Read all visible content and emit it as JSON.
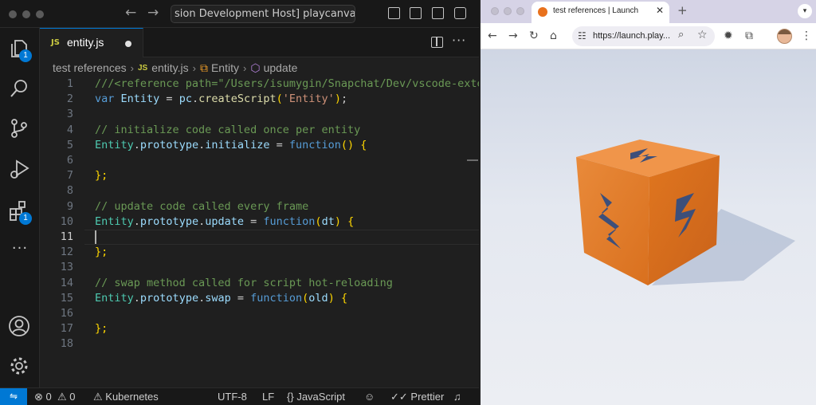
{
  "vscode": {
    "title": "[Extension Development Host] playcanvas (Workspace)",
    "title_visible": "sion Development Host] playcanvas (W",
    "tab": {
      "label": "entity.js",
      "icon_text": "JS",
      "dirty": true
    },
    "breadcrumb": [
      "test references",
      "entity.js",
      "Entity",
      "update"
    ],
    "badges": {
      "explorer": "1",
      "extensions": "1"
    },
    "current_line": 11,
    "lines": [
      {
        "n": "1",
        "tokens": [
          [
            "c",
            "///<reference path=\"/Users/isumygin/Snapchat/Dev/vscode-extensi"
          ]
        ]
      },
      {
        "n": "2",
        "tokens": [
          [
            "k",
            "var "
          ],
          [
            "v",
            "Entity"
          ],
          [
            "p",
            " = "
          ],
          [
            "v",
            "pc"
          ],
          [
            "p",
            "."
          ],
          [
            "f",
            "createScript"
          ],
          [
            "y",
            "("
          ],
          [
            "s",
            "'Entity'"
          ],
          [
            "y",
            ")"
          ],
          [
            "p",
            ";"
          ]
        ]
      },
      {
        "n": "3",
        "tokens": []
      },
      {
        "n": "4",
        "tokens": [
          [
            "c",
            "// initialize code called once per entity"
          ]
        ]
      },
      {
        "n": "5",
        "tokens": [
          [
            "t",
            "Entity"
          ],
          [
            "p",
            "."
          ],
          [
            "v",
            "prototype"
          ],
          [
            "p",
            "."
          ],
          [
            "v",
            "initialize"
          ],
          [
            "p",
            " = "
          ],
          [
            "k",
            "function"
          ],
          [
            "y",
            "() {"
          ]
        ]
      },
      {
        "n": "6",
        "tokens": []
      },
      {
        "n": "7",
        "tokens": [
          [
            "y",
            "};"
          ]
        ]
      },
      {
        "n": "8",
        "tokens": []
      },
      {
        "n": "9",
        "tokens": [
          [
            "c",
            "// update code called every frame"
          ]
        ]
      },
      {
        "n": "10",
        "tokens": [
          [
            "t",
            "Entity"
          ],
          [
            "p",
            "."
          ],
          [
            "v",
            "prototype"
          ],
          [
            "p",
            "."
          ],
          [
            "v",
            "update"
          ],
          [
            "p",
            " = "
          ],
          [
            "k",
            "function"
          ],
          [
            "y",
            "("
          ],
          [
            "v",
            "dt"
          ],
          [
            "y",
            ") {"
          ]
        ]
      },
      {
        "n": "11",
        "tokens": []
      },
      {
        "n": "12",
        "tokens": [
          [
            "y",
            "};"
          ]
        ]
      },
      {
        "n": "13",
        "tokens": []
      },
      {
        "n": "14",
        "tokens": [
          [
            "c",
            "// swap method called for script hot-reloading"
          ]
        ]
      },
      {
        "n": "15",
        "tokens": [
          [
            "t",
            "Entity"
          ],
          [
            "p",
            "."
          ],
          [
            "v",
            "prototype"
          ],
          [
            "p",
            "."
          ],
          [
            "v",
            "swap"
          ],
          [
            "p",
            " = "
          ],
          [
            "k",
            "function"
          ],
          [
            "y",
            "("
          ],
          [
            "v",
            "old"
          ],
          [
            "y",
            ") {"
          ]
        ]
      },
      {
        "n": "16",
        "tokens": []
      },
      {
        "n": "17",
        "tokens": [
          [
            "y",
            "};"
          ]
        ]
      },
      {
        "n": "18",
        "tokens": []
      }
    ],
    "status": {
      "errors": "0",
      "warnings": "0",
      "kubernetes": "Kubernetes",
      "encoding": "UTF-8",
      "eol": "LF",
      "language": "JavaScript",
      "prettier": "Prettier"
    }
  },
  "browser": {
    "tab_title": "test references | Launch",
    "url": "https://launch.play...",
    "colors": {
      "cube": "#e87f2a",
      "floor": "#e6e9f0",
      "shadow": "#b8c2d6"
    }
  }
}
